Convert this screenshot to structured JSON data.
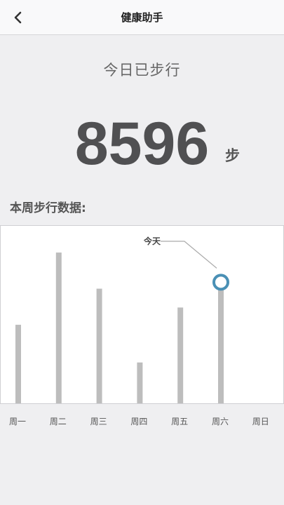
{
  "header": {
    "title": "健康助手",
    "back_icon": "chevron-left-icon"
  },
  "today": {
    "label": "今日已步行",
    "steps": "8596",
    "unit": "步"
  },
  "week": {
    "title": "本周步行数据:"
  },
  "chart_data": {
    "type": "bar",
    "categories": [
      "周一",
      "周二",
      "周三",
      "周四",
      "周五",
      "周六",
      "周日"
    ],
    "values": [
      5000,
      9600,
      7300,
      2600,
      6100,
      7800,
      null
    ],
    "ylim": [
      0,
      11300
    ],
    "grid": false,
    "bar_color": "#bdbdbd",
    "marker_color": "#4a90b5",
    "annotation": {
      "text": "今天",
      "category": "周六"
    }
  }
}
